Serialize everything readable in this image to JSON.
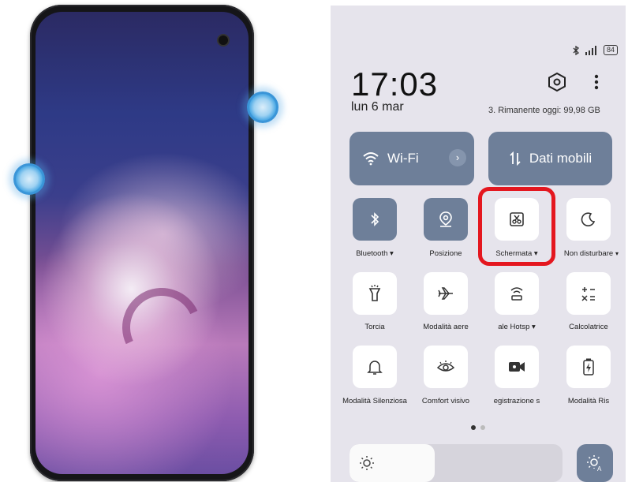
{
  "left_phone": {},
  "control_center": {
    "status": {
      "battery": "84"
    },
    "clock": "17:03",
    "date": "lun 6 mar",
    "data_remaining": "3. Rimanente oggi: 99,98 GB",
    "wifi_label": "Wi-Fi",
    "mobile_data_label": "Dati mobili",
    "tiles": [
      {
        "label": "Bluetooth ▾",
        "icon": "bluetooth-icon"
      },
      {
        "label": "Posizione",
        "icon": "location-icon"
      },
      {
        "label": "Schermata ▾",
        "icon": "screenshot-icon"
      },
      {
        "label": "Non disturbare",
        "icon": "moon-icon"
      },
      {
        "label": "Torcia",
        "icon": "flashlight-icon"
      },
      {
        "label": "Modalità aere",
        "icon": "airplane-icon"
      },
      {
        "label": "ale   Hotsp ▾",
        "icon": "hotspot-icon"
      },
      {
        "label": "Calcolatrice",
        "icon": "calculator-icon"
      },
      {
        "label": "Modalità Silenziosa",
        "icon": "bell-icon"
      },
      {
        "label": "Comfort visivo",
        "icon": "eye-icon"
      },
      {
        "label": "egistrazione s",
        "icon": "video-record-icon"
      },
      {
        "label": "Modalità Ris",
        "icon": "battery-saver-icon"
      }
    ],
    "brightness_level": 0.4,
    "highlight_color": "#e4171f",
    "accent_color": "#6e7f99"
  }
}
